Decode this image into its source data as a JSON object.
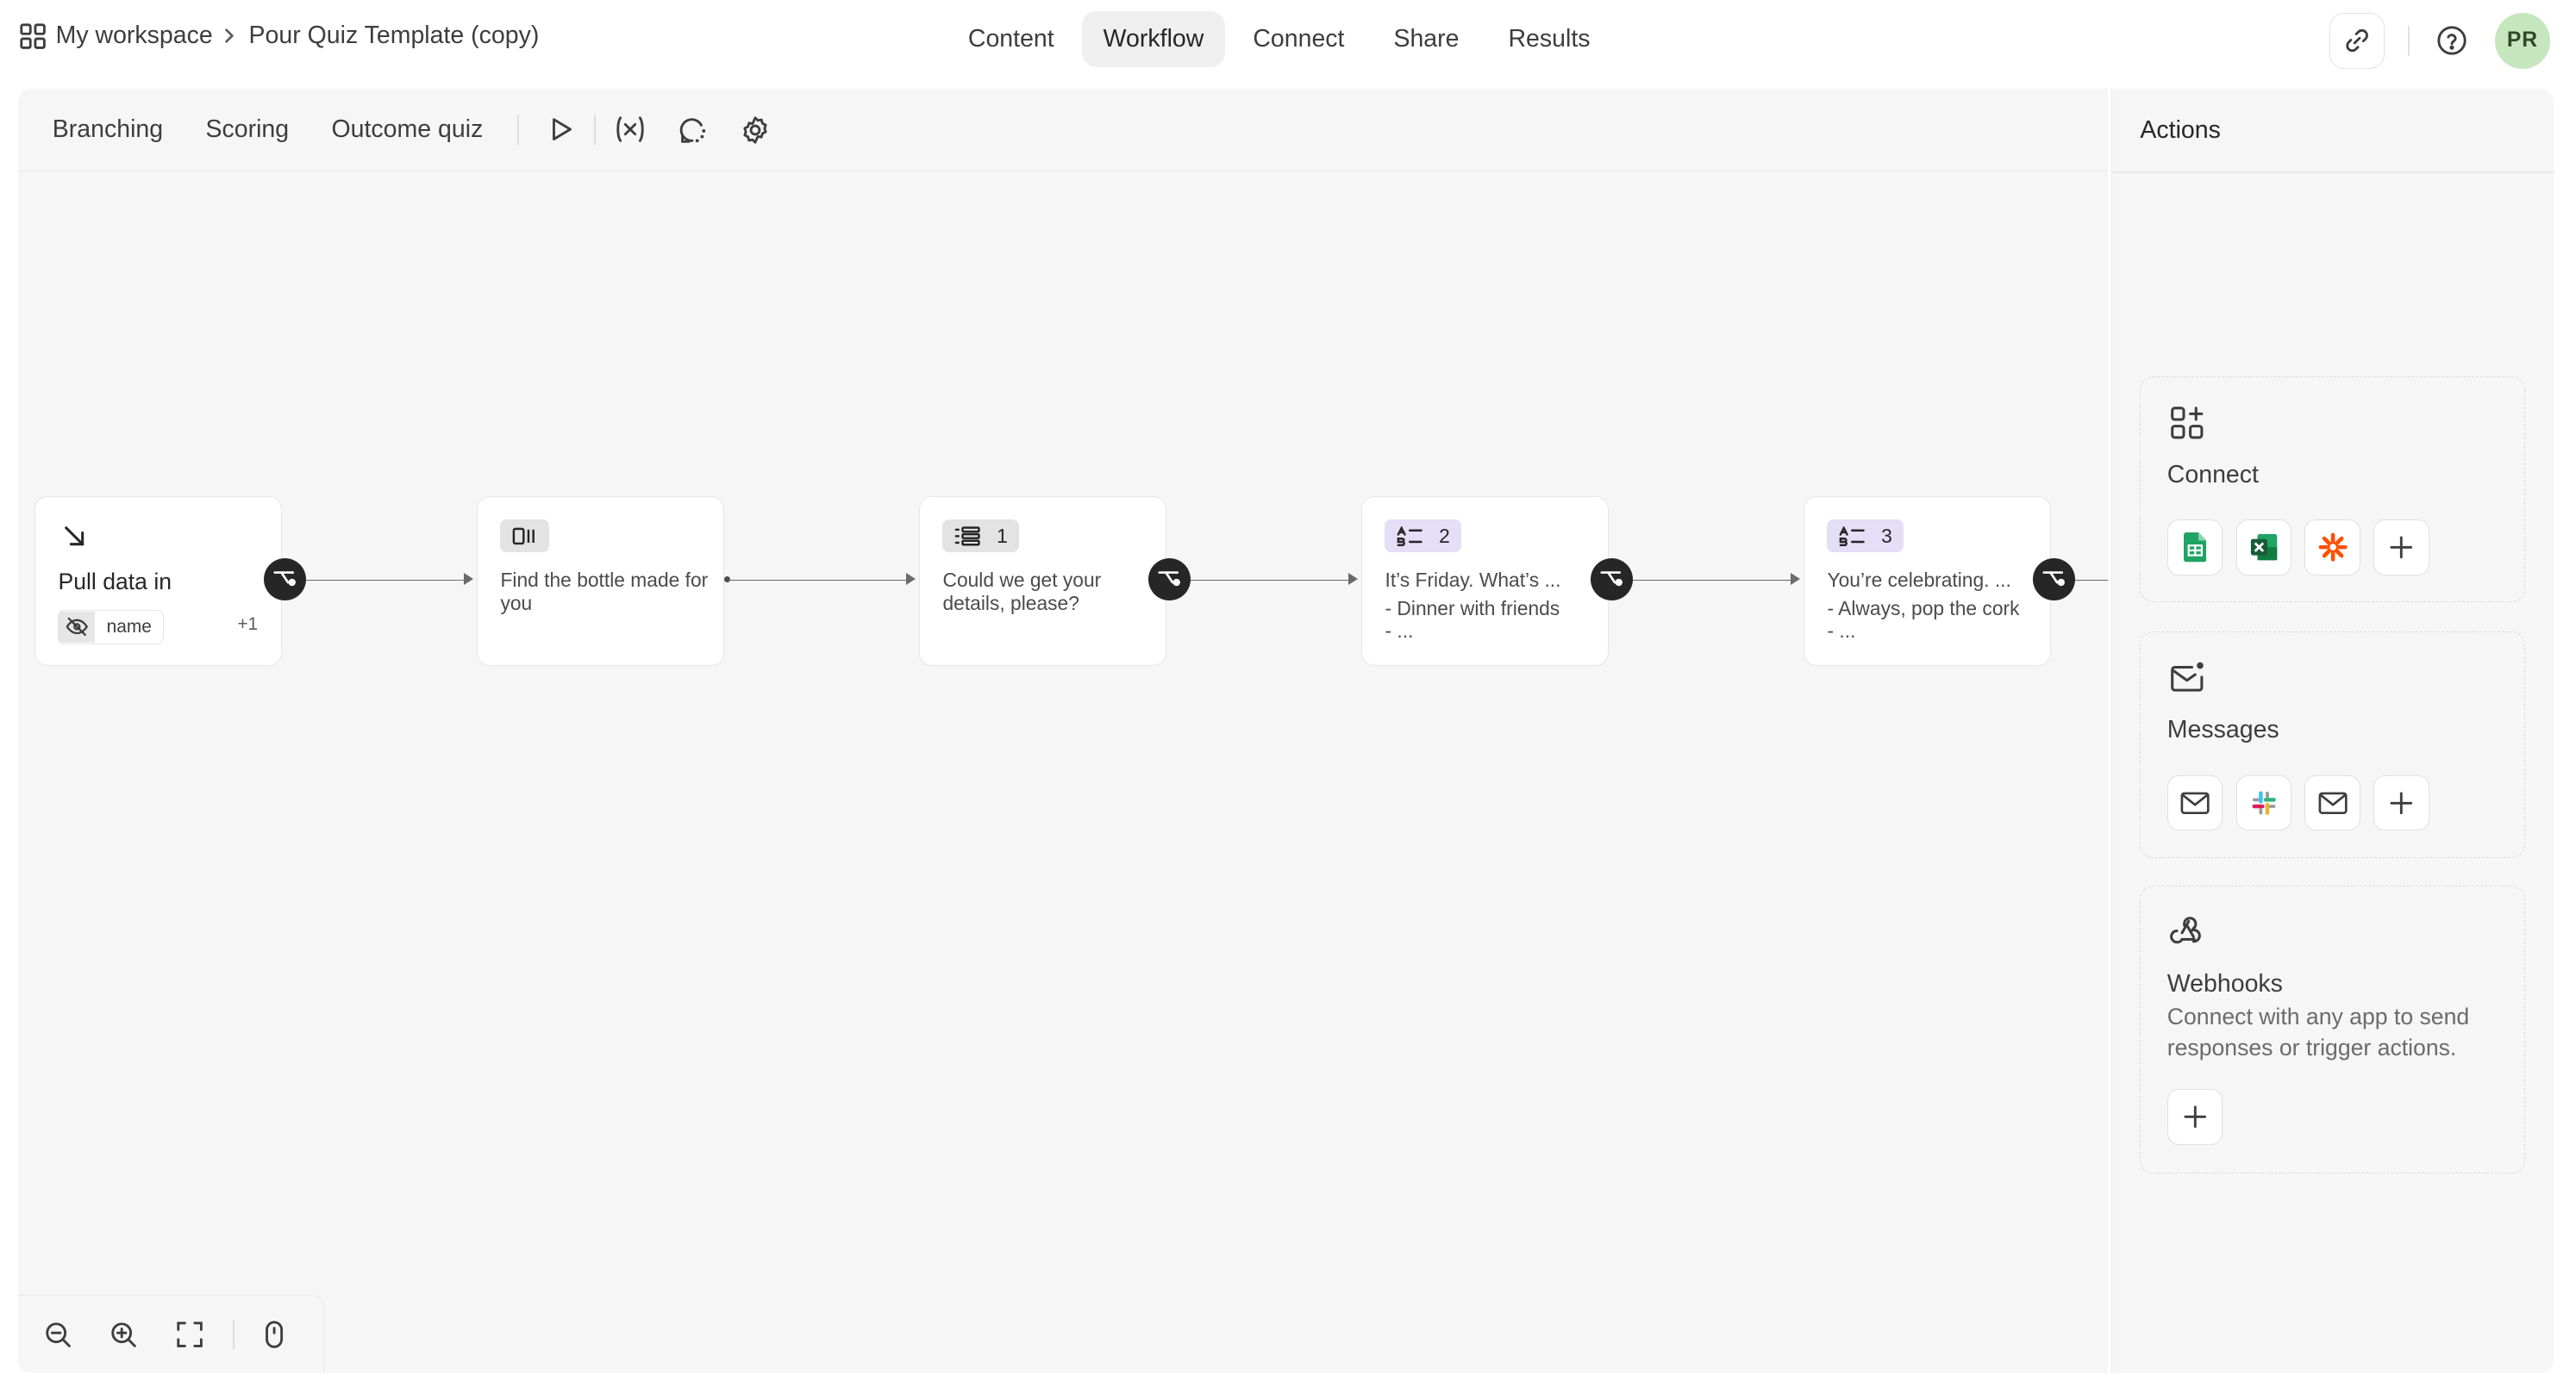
{
  "breadcrumb": {
    "workspace": "My workspace",
    "form": "Pour Quiz Template (copy)"
  },
  "nav": {
    "tabs": [
      {
        "label": "Content"
      },
      {
        "label": "Workflow",
        "active": true
      },
      {
        "label": "Connect"
      },
      {
        "label": "Share"
      },
      {
        "label": "Results"
      }
    ]
  },
  "user": {
    "initials": "PR"
  },
  "toolbar": {
    "tabs": [
      "Branching",
      "Scoring",
      "Outcome quiz"
    ],
    "icons": [
      "play-icon",
      "variable-icon",
      "loop-icon",
      "settings-icon"
    ]
  },
  "nodes": [
    {
      "type": "pull-data",
      "title": "Pull data in",
      "chip": "name",
      "extra": "+1"
    },
    {
      "type": "welcome",
      "title": "Find the bottle made for you"
    },
    {
      "type": "contact",
      "number": "1",
      "title": "Could we get your details, please?"
    },
    {
      "type": "choice",
      "number": "2",
      "title": "It’s Friday. What’s ...",
      "line2": "- Dinner with friends",
      "line3": "- ..."
    },
    {
      "type": "choice",
      "number": "3",
      "title": "You’re celebrating. ...",
      "line2": "- Always, pop the cork",
      "line3": "- ..."
    }
  ],
  "actions": {
    "title": "Actions",
    "connect": {
      "title": "Connect",
      "apps": [
        "google-sheets-icon",
        "excel-icon",
        "zapier-icon"
      ]
    },
    "messages": {
      "title": "Messages",
      "apps": [
        "mail-icon",
        "slack-icon",
        "mail-icon"
      ]
    },
    "webhooks": {
      "title": "Webhooks",
      "description": "Connect with any app to send responses or trigger actions."
    }
  },
  "colors": {
    "canvas": "#f6f6f6",
    "branch": "#262627",
    "purple_badge": "#e4def7",
    "avatar": "#c6e6be"
  }
}
